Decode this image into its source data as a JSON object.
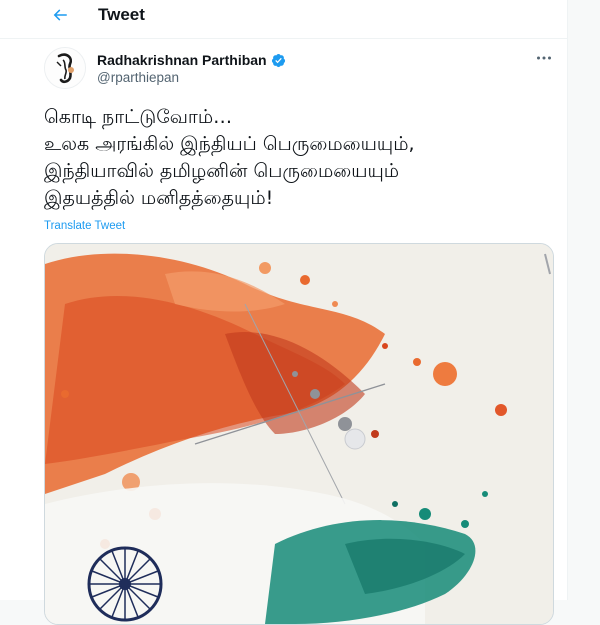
{
  "header": {
    "title": "Tweet"
  },
  "tweet": {
    "author": {
      "display_name": "Radhakrishnan Parthiban",
      "handle": "@rparthiepan",
      "verified": true
    },
    "text_lines": [
      "கொடி நாட்டுவோம்…",
      "உலக அரங்கில் இந்தியப் பெருமையையும்,",
      "இந்தியாவில் தமிழனின் பெருமையையும்",
      "இதயத்தில் மனிதத்தையும்!"
    ],
    "translate_label": "Translate Tweet"
  },
  "colors": {
    "accent": "#1d9bf0",
    "text_primary": "#0f1419",
    "text_secondary": "#536471",
    "saffron": "#e8642a",
    "green": "#178a78",
    "chakra_navy": "#1f2d5a"
  },
  "icons": {
    "back": "arrow-left-icon",
    "verified": "verified-badge-icon",
    "more": "more-horizontal-icon"
  }
}
